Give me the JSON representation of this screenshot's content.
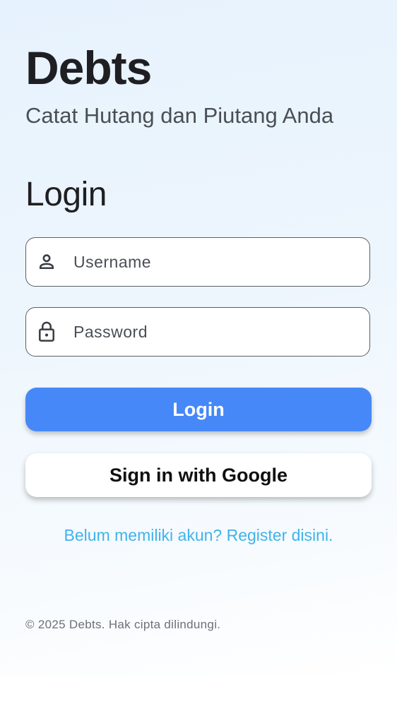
{
  "header": {
    "app_title": "Debts",
    "subtitle": "Catat Hutang dan Piutang Anda"
  },
  "login_form": {
    "heading": "Login",
    "username": {
      "placeholder": "Username",
      "value": "",
      "icon": "person-icon"
    },
    "password": {
      "placeholder": "Password",
      "value": "",
      "icon": "lock-icon"
    },
    "login_button_label": "Login",
    "google_button_label": "Sign in with Google",
    "register_link": "Belum memiliki akun? Register disini."
  },
  "footer": {
    "copyright": "© 2025 Debts. Hak cipta dilindungi."
  },
  "colors": {
    "primary": "#4688f7",
    "link": "#3fb3ec",
    "text_dark": "#1f1f23",
    "background_top": "#e6f2fd"
  }
}
